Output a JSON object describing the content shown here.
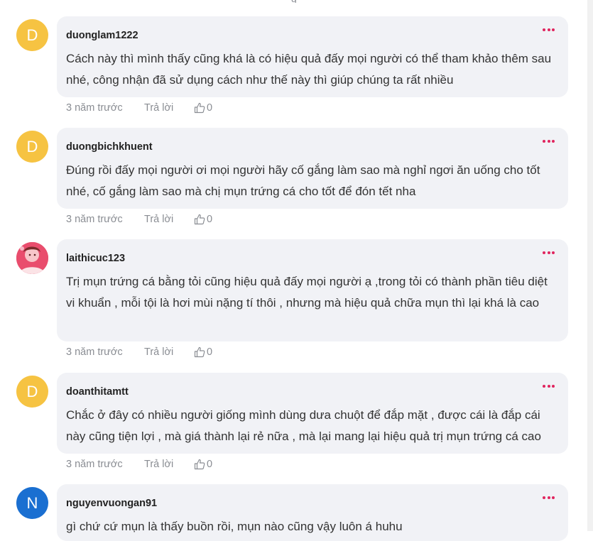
{
  "comments": [
    {
      "avatar_letter": "D",
      "avatar_color": "#f6c342",
      "username": "duonglam1222",
      "text": "Cách này thì mình thấy cũng khá là có hiệu quả đấy mọi người có thể tham khảo thêm sau nhé, công nhận đã sử dụng cách như thế này thì giúp chúng ta rất nhiều",
      "time": "3 năm trước",
      "reply": "Trả lời",
      "likes": "0"
    },
    {
      "avatar_letter": "D",
      "avatar_color": "#f6c342",
      "username": "duongbichkhuent",
      "text": "Đúng rồi đấy mọi người ơi mọi người hãy cố gắng làm sao mà nghỉ ngơi ăn uống cho tốt nhé, cố gắng làm sao mà chị mụn trứng cá cho tốt để đón tết nha",
      "time": "3 năm trước",
      "reply": "Trả lời",
      "likes": "0"
    },
    {
      "avatar_letter": "",
      "avatar_color": "#e94d6d",
      "avatar_icon": "photo-avatar-icon",
      "username": "laithicuc123",
      "text": "Trị mụn trứng cá bằng tỏi cũng hiệu quả đấy mọi người ạ ,trong tỏi có thành phần tiêu diệt vi khuẩn , mỗi tội là hơi mùi nặng tí thôi , nhưng mà hiệu quả chữa mụn thì lại khá là cao",
      "time": "3 năm trước",
      "reply": "Trả lời",
      "likes": "0"
    },
    {
      "avatar_letter": "D",
      "avatar_color": "#f6c342",
      "username": "doanthitamtt",
      "text": "Chắc ở đây có nhiều người giống mình dùng dưa chuột để đắp mặt , được cái là đắp cái này cũng tiện lợi , mà giá thành lại rẻ nữa , mà lại mang lại hiệu quả trị mụn trứng cá cao",
      "time": "3 năm trước",
      "reply": "Trả lời",
      "likes": "0"
    },
    {
      "avatar_letter": "N",
      "avatar_color": "#1a6fd1",
      "username": "nguyenvuongan91",
      "text": "gì chứ cứ mụn là thấy buồn rồi, mụn nào cũng vậy luôn á huhu",
      "time": "",
      "reply": "",
      "likes": ""
    }
  ],
  "icons": {
    "more": "more-options-icon",
    "like": "thumbs-up-icon"
  },
  "colors": {
    "accent_dots": "#e0245e",
    "bubble_bg": "#f1f2f6",
    "meta_text": "#8a8d93"
  }
}
